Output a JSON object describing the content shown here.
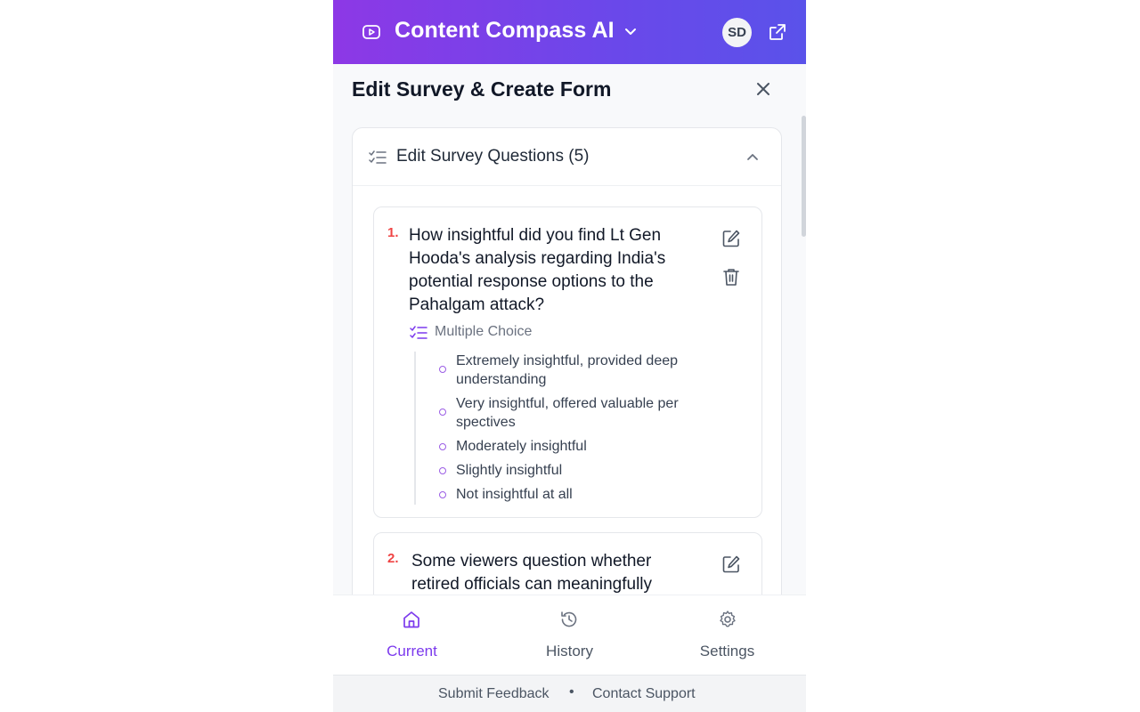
{
  "header": {
    "app_title": "Content Compass AI",
    "avatar_initials": "SD",
    "icons": [
      "video-icon",
      "chevron-down-icon",
      "external-link-icon"
    ]
  },
  "panel": {
    "title": "Edit Survey & Create Form",
    "close_icon": "close-icon"
  },
  "section": {
    "label": "Edit Survey Questions (5)",
    "icon": "list-check-icon",
    "toggle_icon": "chevron-up-icon"
  },
  "questions": [
    {
      "number": "1.",
      "lines": [
        "How insightful did you find Lt Gen",
        "Hooda's analysis regarding India's",
        "potential response options to the",
        "Pahalgam attack?"
      ],
      "type": "Multiple Choice",
      "options": [
        [
          "Extremely insightful, provided deep",
          "understanding"
        ],
        [
          "Very insightful, offered valuable per",
          "spectives"
        ],
        [
          "Moderately insightful"
        ],
        [
          "Slightly insightful"
        ],
        [
          "Not insightful at all"
        ]
      ]
    },
    {
      "number": "2.",
      "lines": [
        "Some viewers question whether",
        "retired officials can meaningfully"
      ]
    }
  ],
  "nav": [
    {
      "label": "Current",
      "icon": "home-icon",
      "active": true
    },
    {
      "label": "History",
      "icon": "history-icon",
      "active": false
    },
    {
      "label": "Settings",
      "icon": "gear-icon",
      "active": false
    }
  ],
  "footer": {
    "feedback": "Submit Feedback",
    "separator": "•",
    "support": "Contact Support"
  },
  "colors": {
    "accent": "#7c3aed",
    "header_start": "#8d38e6",
    "header_end": "#5a52ea",
    "number_red": "#ef4444"
  }
}
